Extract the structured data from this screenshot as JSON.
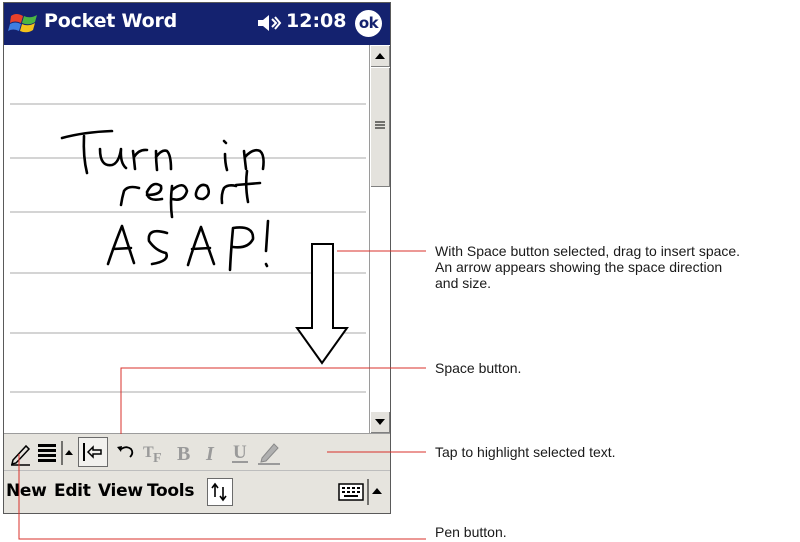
{
  "titlebar": {
    "title": "Pocket Word",
    "time": "12:08",
    "ok_label": "ok"
  },
  "note": {
    "ink_text": "Turn in report ASAP!"
  },
  "menubar": {
    "items": [
      "New",
      "Edit",
      "View",
      "Tools"
    ]
  },
  "callouts": {
    "space_drag_line1": "With Space button selected, drag to insert space.",
    "space_drag_line2": "An arrow appears showing the space direction",
    "space_drag_line3": "and size.",
    "space_button": "Space button.",
    "highlight": "Tap to highlight selected text.",
    "pen_button": "Pen button."
  },
  "colors": {
    "titlebar": "#14226f",
    "leader_line": "#d8312b",
    "toolbar": "#e6e4de"
  },
  "icons": {
    "start": "windows-flag-icon",
    "volume": "speaker-icon",
    "pen": "pen-icon",
    "lines": "line-spacing-icon",
    "space": "space-icon",
    "undo": "undo-icon",
    "font": "font-icon",
    "bold": "bold-icon",
    "italic": "italic-icon",
    "underline": "underline-icon",
    "highlight": "highlighter-icon",
    "keyboard": "keyboard-icon"
  }
}
